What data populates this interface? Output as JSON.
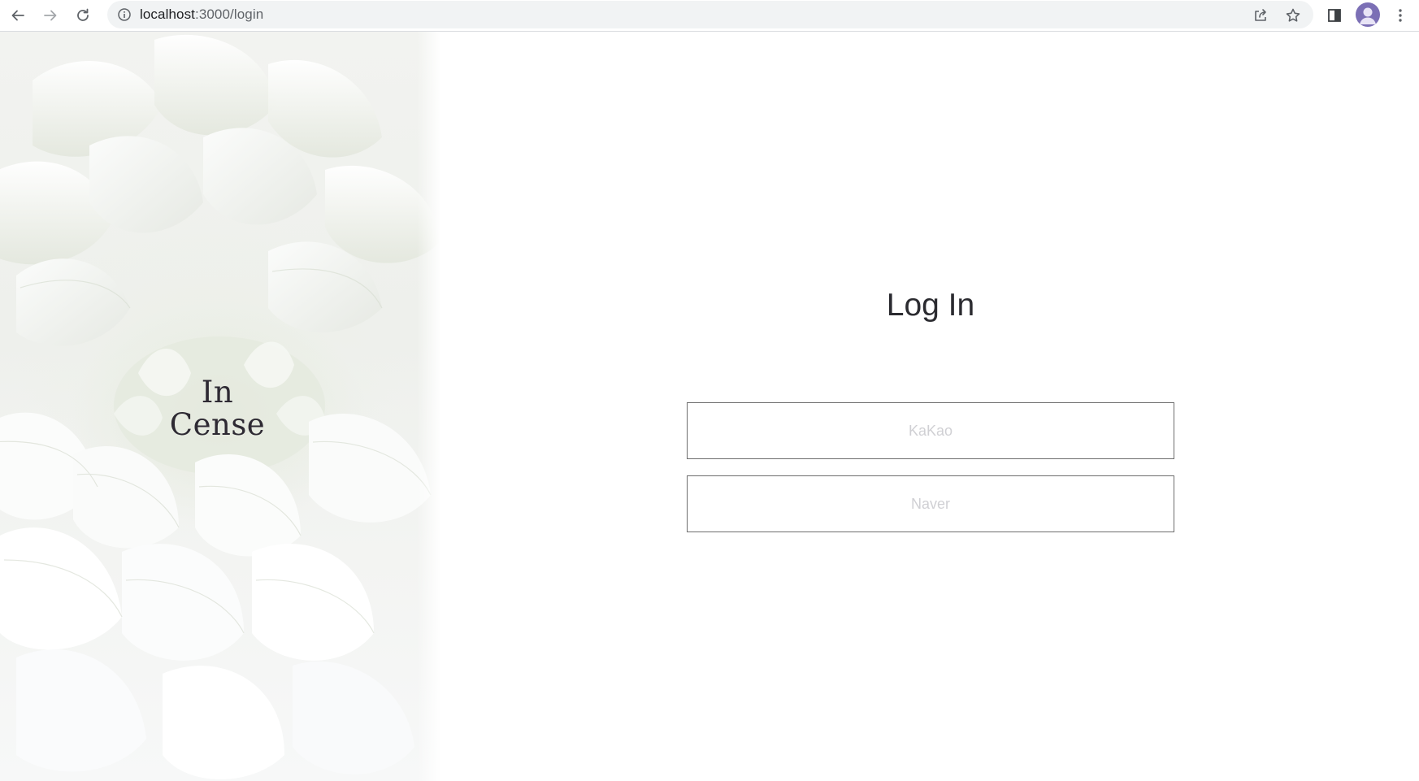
{
  "browser": {
    "url_host": "localhost",
    "url_path": ":3000/login",
    "icons": {
      "back": "arrow-left-icon",
      "forward": "arrow-right-icon",
      "reload": "reload-icon",
      "site_info": "info-icon",
      "share": "share-icon",
      "bookmark": "star-icon",
      "side_panel": "side-panel-icon",
      "profile": "avatar",
      "menu": "kebab-menu-icon"
    }
  },
  "hero": {
    "logo_line1": "In",
    "logo_line2": "Cense"
  },
  "login": {
    "title": "Log In",
    "kakao_label": "KaKao",
    "naver_label": "Naver"
  },
  "colors": {
    "accent_avatar": "#7b6fb5",
    "button_border": "#6d6d6d",
    "button_text": "#d0d0d4",
    "title_text": "#2b2b30"
  }
}
